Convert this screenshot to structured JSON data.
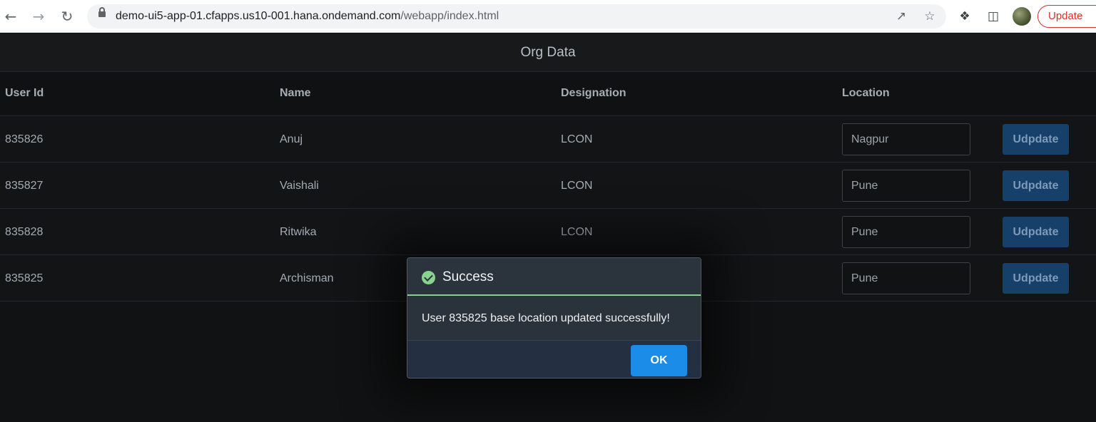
{
  "browser": {
    "url_host": "demo-ui5-app-01.cfapps.us10-001.hana.ondemand.com",
    "url_path": "/webapp/index.html",
    "update_label": "Update",
    "icons": [
      "back-icon",
      "forward-icon",
      "reload-icon",
      "lock-icon",
      "share-icon",
      "star-icon",
      "extensions-icon",
      "side-panel-icon",
      "avatar"
    ]
  },
  "app": {
    "title": "Org Data",
    "columns": [
      "User Id",
      "Name",
      "Designation",
      "Location"
    ],
    "rows": [
      {
        "user_id": "835826",
        "name": "Anuj",
        "designation": "LCON",
        "location": "Nagpur",
        "button": "Udpdate"
      },
      {
        "user_id": "835827",
        "name": "Vaishali",
        "designation": "LCON",
        "location": "Pune",
        "button": "Udpdate"
      },
      {
        "user_id": "835828",
        "name": "Ritwika",
        "designation": "LCON",
        "location": "Pune",
        "button": "Udpdate"
      },
      {
        "user_id": "835825",
        "name": "Archisman",
        "designation": "",
        "location": "Pune",
        "button": "Udpdate"
      }
    ]
  },
  "dialog": {
    "title": "Success",
    "message": "User 835825 base location updated successfully!",
    "ok_label": "OK",
    "accent_color": "#87d38f",
    "button_color": "#1b8ce8"
  }
}
